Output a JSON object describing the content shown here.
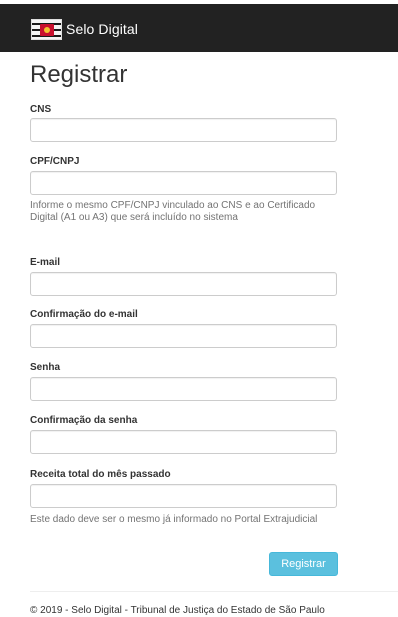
{
  "navbar": {
    "brand_name": "Selo Digital",
    "logo_icon": "tjsp-logo-icon",
    "background": "#222222"
  },
  "page": {
    "title": "Registrar"
  },
  "form": {
    "cns": {
      "label": "CNS",
      "value": "",
      "placeholder": ""
    },
    "cpf_cnpj": {
      "label": "CPF/CNPJ",
      "value": "",
      "placeholder": "",
      "help": "Informe o mesmo CPF/CNPJ vinculado ao CNS e ao Certificado Digital (A1 ou A3) que será incluído no sistema"
    },
    "email": {
      "label": "E-mail",
      "value": "",
      "placeholder": ""
    },
    "email_confirm": {
      "label": "Confirmação do e-mail",
      "value": "",
      "placeholder": ""
    },
    "password": {
      "label": "Senha",
      "value": "",
      "placeholder": ""
    },
    "password_confirm": {
      "label": "Confirmação da senha",
      "value": "",
      "placeholder": ""
    },
    "revenue": {
      "label": "Receita total do mês passado",
      "value": "",
      "placeholder": "",
      "help": "Este dado deve ser o mesmo já informado no Portal Extrajudicial"
    },
    "submit_label": "Registrar",
    "submit_color": "#5bc0de"
  },
  "footer": {
    "text": "© 2019 - Selo Digital - Tribunal de Justiça do Estado de São Paulo"
  }
}
